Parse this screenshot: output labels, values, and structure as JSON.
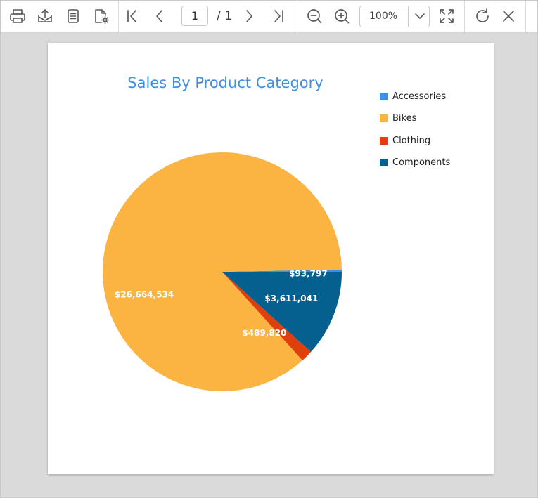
{
  "toolbar": {
    "icons": {
      "print": "printer-icon",
      "export": "export-icon",
      "parameters": "document-list-icon",
      "page_setup": "page-setup-icon",
      "first": "first-page-icon",
      "prev": "previous-page-icon",
      "next": "next-page-icon",
      "last": "last-page-icon",
      "zoom_out": "zoom-out-icon",
      "zoom_in": "zoom-in-icon",
      "fit": "fit-page-icon",
      "refresh": "refresh-icon",
      "close": "close-icon"
    },
    "current_page": "1",
    "total_pages": "/ 1",
    "zoom": "100%",
    "icon_color": "#5a5a5a"
  },
  "chart_data": {
    "type": "pie",
    "title": "Sales By Product Category",
    "legend_position": "top-right",
    "series": [
      {
        "name": "Accessories",
        "value": 93797,
        "label": "$93,797",
        "color": "#3c8ee6"
      },
      {
        "name": "Bikes",
        "value": 26664534,
        "label": "$26,664,534",
        "color": "#fbb341"
      },
      {
        "name": "Clothing",
        "value": 489820,
        "label": "$489,820",
        "color": "#df3f0c"
      },
      {
        "name": "Components",
        "value": 3611041,
        "label": "$3,611,041",
        "color": "#04618f"
      }
    ]
  }
}
